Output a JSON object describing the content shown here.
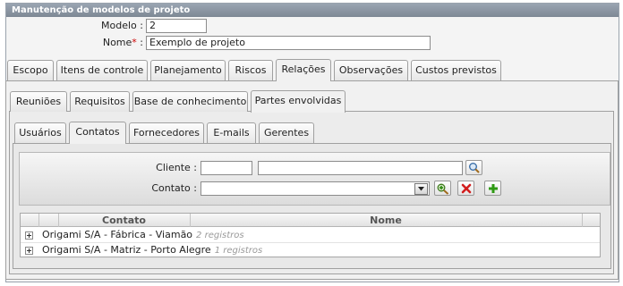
{
  "panel": {
    "title": "Manutenção de modelos de projeto"
  },
  "form": {
    "modelo_label": "Modelo :",
    "modelo_value": "2",
    "nome_label": "Nome",
    "nome_required": "*",
    "nome_colon": " :",
    "nome_value": "Exemplo de projeto"
  },
  "tabs_main": [
    "Escopo",
    "Itens de controle",
    "Planejamento",
    "Riscos",
    "Relações",
    "Observações",
    "Custos previstos"
  ],
  "tabs_relacoes": [
    "Reuniões",
    "Requisitos",
    "Base de conhecimento",
    "Partes envolvidas"
  ],
  "tabs_partes": [
    "Usuários",
    "Contatos",
    "Fornecedores",
    "E-mails",
    "Gerentes"
  ],
  "filter": {
    "cliente_label": "Cliente :",
    "contato_label": "Contato :",
    "cliente_code": "",
    "cliente_name": "",
    "contato_value": ""
  },
  "grid": {
    "columns": [
      "Contato",
      "Nome"
    ],
    "rows": [
      {
        "name": "Origami S/A - Fábrica - Viamão",
        "count": "2 registros"
      },
      {
        "name": "Origami S/A - Matriz - Porto Alegre",
        "count": "1 registros"
      }
    ]
  },
  "icons": {
    "search": "magnifier-icon",
    "add_search": "add-search-icon",
    "remove": "red-x-icon",
    "add": "green-plus-icon"
  }
}
